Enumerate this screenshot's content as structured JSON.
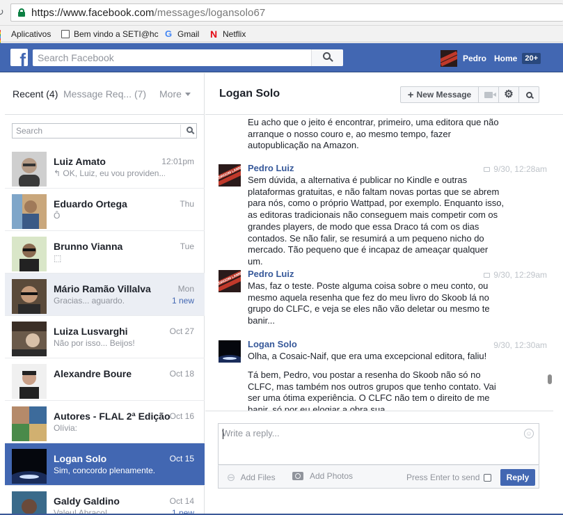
{
  "browser": {
    "url_host": "https://www.facebook.com",
    "url_path": "/messages/logansolo67",
    "bookmarks": [
      "Aplicativos",
      "Bem vindo a SETI@hc",
      "Gmail",
      "Netflix"
    ]
  },
  "topbar": {
    "search_placeholder": "Search Facebook",
    "user_name": "Pedro",
    "home_label": "Home",
    "home_count": "20+"
  },
  "sidebar": {
    "tab_recent": "Recent",
    "tab_recent_count": "(4)",
    "tab_requests": "Message Req... (7)",
    "tab_more": "More",
    "search_placeholder": "Search",
    "conversations": [
      {
        "name": "Luiz Amato",
        "time": "12:01pm",
        "snippet": "↰ OK, Luiz, eu vou providen..."
      },
      {
        "name": "Eduardo Ortega",
        "time": "Thu",
        "snippet": "Ô"
      },
      {
        "name": "Brunno Vianna",
        "time": "Tue",
        "snippet": "⬚"
      },
      {
        "name": "Mário Ramão Villalva",
        "time": "Mon",
        "snippet": "Gracias... aguardo.",
        "badge": "1 new"
      },
      {
        "name": "Luiza Lusvarghi",
        "time": "Oct 27",
        "snippet": "Não por isso... Beijos!"
      },
      {
        "name": "Alexandre Boure",
        "time": "Oct 18",
        "snippet": ""
      },
      {
        "name": "Autores - FLAL 2ª Edição",
        "time": "Oct 16",
        "snippet": "Olívia:"
      },
      {
        "name": "Logan Solo",
        "time": "Oct 15",
        "snippet": "Sim, concordo plenamente."
      },
      {
        "name": "Galdy Galdino",
        "time": "Oct 14",
        "snippet": "Valeu! Abraço!",
        "badge": "1 new"
      }
    ]
  },
  "thread": {
    "title": "Logan Solo",
    "new_message_label": "New Message",
    "messages": [
      {
        "sender": "",
        "time": "",
        "text": "Eu acho que o jeito é encontrar, primeiro, uma editora que não arranque o nosso couro e, ao mesmo tempo, fazer autopublicação na Amazon."
      },
      {
        "sender": "Pedro Luiz",
        "time": "9/30, 12:28am",
        "text": "Sem dúvida, a alternativa é publicar no Kindle e outras plataformas gratuitas, e não faltam novas portas que se abrem para nós, como o próprio Wattpad, por exemplo. Enquanto isso, as editoras tradicionais não conseguem mais competir com os grandes players, de modo que essa Draco tá com os dias contados. Se não falir, se resumirá a um pequeno nicho do mercado. Tão pequeno que é incapaz de ameaçar qualquer um."
      },
      {
        "sender": "Pedro Luiz",
        "time": "9/30, 12:29am",
        "text": "Mas, faz o teste. Poste alguma coisa sobre o meu conto, ou mesmo aquela resenha que fez do meu livro do Skoob lá no grupo do CLFC, e veja se eles não vão deletar ou mesmo te banir..."
      },
      {
        "sender": "Logan Solo",
        "time": "9/30, 12:30am",
        "text": "Olha, a Cosaic-Naif, que era uma excepcional editora, faliu!"
      },
      {
        "sender": "",
        "time": "",
        "text": "Tá bem, Pedro, vou postar a resenha do Skoob não só no CLFC, mas também nos outros grupos que tenho contato. Vai ser uma ótima experiência. O CLFC não tem o direito de me banir, só por eu elogiar a obra sua..."
      }
    ],
    "avatar_caption": "PEDROOM LANNE"
  },
  "composer": {
    "placeholder": "Write a reply...",
    "add_files": "Add Files",
    "add_photos": "Add Photos",
    "press_enter": "Press Enter to send",
    "reply": "Reply"
  },
  "colors": {
    "fb_blue": "#4267b2",
    "link_blue": "#365899",
    "unread_bg": "#ebeef4"
  }
}
